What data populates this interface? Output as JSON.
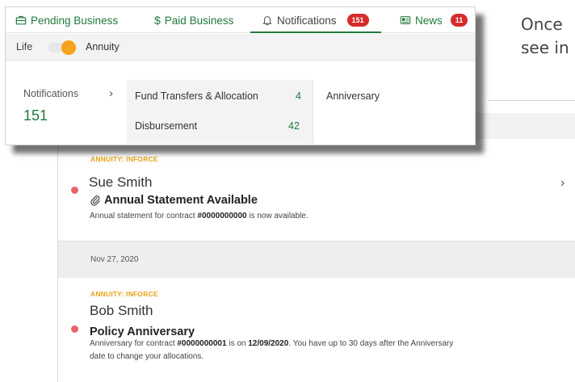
{
  "intro_text": "Once\nsee in",
  "feed": {
    "item1": {
      "tag": "ANNUITY: INFORCE",
      "name": "Sue Smith",
      "subject": "Annual Statement Available",
      "desc_prefix": "Annual statement for contract ",
      "desc_contract": "#0000000000",
      "desc_suffix": " is now available."
    },
    "date_header": "Nov 27, 2020",
    "item2": {
      "tag": "ANNUITY: INFORCE",
      "name": "Bob Smith",
      "subject": "Policy Anniversary",
      "desc_1": "Anniversary for contract ",
      "desc_contract": "#0000000001",
      "desc_2": " is on ",
      "desc_date": "12/09/2020",
      "desc_3": ". You have up to 30 days after the Anniversary",
      "desc_line2": "date to change your allocations."
    }
  },
  "popup": {
    "tabs": [
      {
        "label": "Pending Business",
        "icon": "briefcase-icon"
      },
      {
        "label": "Paid Business",
        "icon": "dollar-icon"
      },
      {
        "label": "Notifications",
        "icon": "bell-icon",
        "badge": "151",
        "active": true
      },
      {
        "label": "News",
        "icon": "newspaper-icon",
        "badge": "11"
      }
    ],
    "paid_prefix": "$",
    "toggle": {
      "left_label": "Life",
      "right_label": "Annuity",
      "selected": "Annuity"
    },
    "notifications_label": "Notifications",
    "notifications_count": "151",
    "categories": [
      {
        "label": "Fund Transfers & Allocation",
        "count": "4"
      },
      {
        "label": "Disbursement",
        "count": "42"
      }
    ],
    "sub_categories": [
      {
        "label": "Anniversary"
      }
    ]
  },
  "colors": {
    "accent_green": "#1f7a3a",
    "badge_red": "#d62b2b",
    "toggle_orange": "#f7a21b",
    "tag_orange": "#e8a317",
    "unread_dot": "#e8636b"
  }
}
